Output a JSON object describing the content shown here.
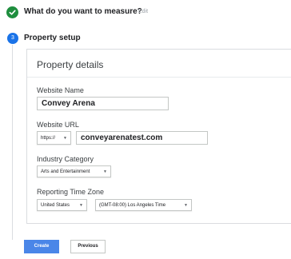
{
  "step1": {
    "title": "What do you want to measure?",
    "edit_label": "Edit"
  },
  "step2": {
    "number": "3",
    "title": "Property setup"
  },
  "card": {
    "title": "Property details",
    "website_name": {
      "label": "Website Name",
      "value": "Convey Arena"
    },
    "website_url": {
      "label": "Website URL",
      "protocol": "https://",
      "value": "conveyarenatest.com"
    },
    "industry": {
      "label": "Industry Category",
      "value": "Arts and Entertainment"
    },
    "timezone": {
      "label": "Reporting Time Zone",
      "country": "United States",
      "zone": "(GMT-08:00) Los Angeles Time"
    }
  },
  "buttons": {
    "create": "Create",
    "previous": "Previous"
  },
  "icons": {
    "caret": "▼",
    "check": "check-icon"
  },
  "colors": {
    "success": "#1e8e3e",
    "primary": "#1a73e8",
    "create_button": "#4a86e8"
  }
}
